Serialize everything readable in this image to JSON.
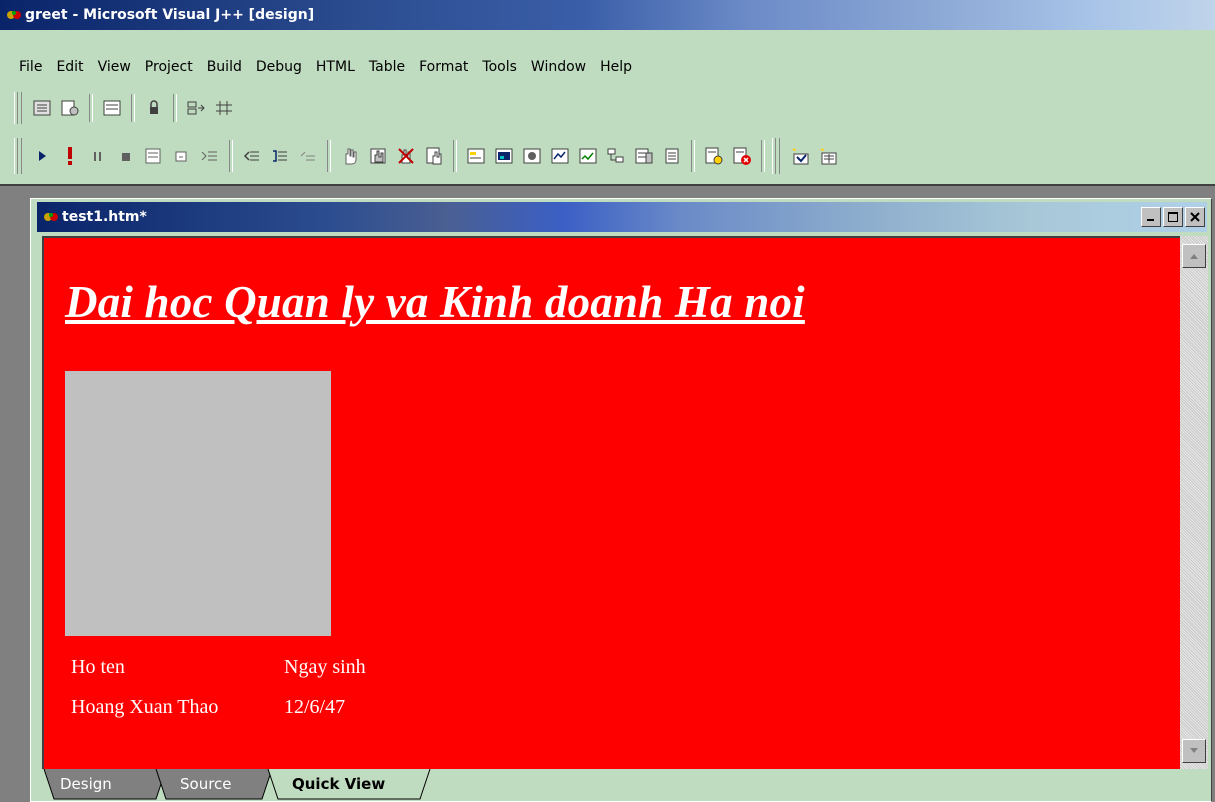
{
  "window": {
    "title": "greet - Microsoft Visual J++ [design]"
  },
  "menu": [
    "File",
    "Edit",
    "View",
    "Project",
    "Build",
    "Debug",
    "HTML",
    "Table",
    "Format",
    "Tools",
    "Window",
    "Help"
  ],
  "toolbar1": [
    "toolbox-icon",
    "properties-icon",
    "layout-icon",
    "lock-icon",
    "snap-grid-icon",
    "grid-icon"
  ],
  "toolbar2": [
    "run-icon",
    "stop-debug-icon",
    "pause-icon",
    "stop-icon",
    "step-into-icon",
    "step-out-icon",
    "indent-icon",
    "outdent-icon",
    "comment-icon",
    "uncomment-icon",
    "hand-icon",
    "breakpoint-icon",
    "delete-breakpoint-icon",
    "clear-icon",
    "form-icon",
    "image-icon",
    "control-icon",
    "table-icon",
    "list-icon",
    "tree-icon",
    "frame-icon",
    "document-icon",
    "build-icon",
    "stop-build-icon",
    "wizard-icon",
    "add-class-icon"
  ],
  "document": {
    "title": "test1.htm*",
    "heading": "Dai hoc Quan ly va Kinh doanh Ha noi",
    "table": [
      [
        "Ho ten",
        "Ngay sinh"
      ],
      [
        "Hoang Xuan Thao",
        "12/6/47"
      ]
    ]
  },
  "tabs": [
    {
      "label": "Design",
      "active": false
    },
    {
      "label": "Source",
      "active": false
    },
    {
      "label": "Quick View",
      "active": true
    }
  ],
  "colors": {
    "page_bg": "#ff0000",
    "photo_bg": "#c0c0c0",
    "chrome_bg": "#c0dcc0"
  }
}
